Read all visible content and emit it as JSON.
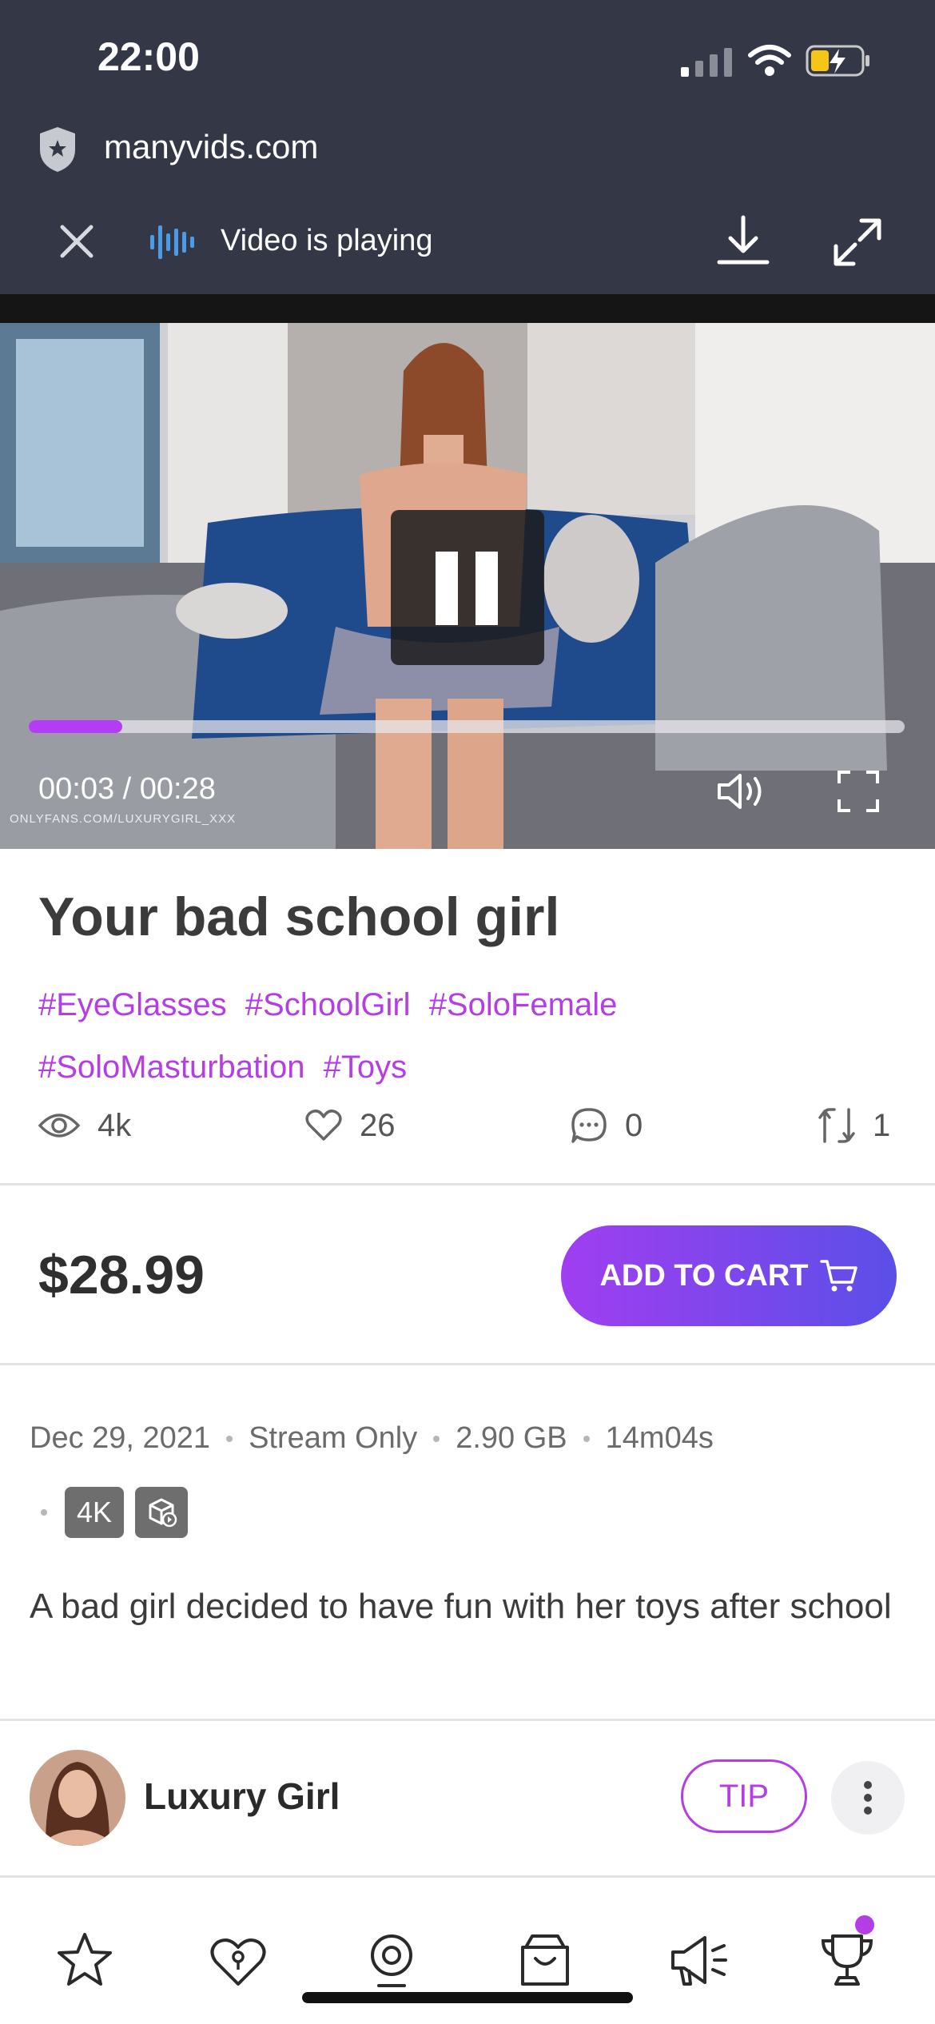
{
  "status_bar": {
    "time": "22:00"
  },
  "browser": {
    "url": "manyvids.com",
    "playing_label": "Video is playing"
  },
  "video": {
    "current_time": "00:03",
    "duration": "00:28",
    "time_display": "00:03 / 00:28",
    "progress_fraction": 0.107,
    "watermark": "ONLYFANS.COM/LUXURYGIRL_XXX"
  },
  "product": {
    "title": "Your bad school girl",
    "tags": [
      "#EyeGlasses",
      "#SchoolGirl",
      "#SoloFemale",
      "#SoloMasturbation",
      "#Toys"
    ],
    "stats": {
      "views": "4k",
      "likes": "26",
      "comments": "0",
      "reposts": "1"
    },
    "price": "$28.99",
    "add_to_cart_label": "ADD TO CART"
  },
  "details": {
    "date": "Dec 29, 2021",
    "stream": "Stream Only",
    "size": "2.90 GB",
    "length": "14m04s",
    "quality_badge": "4K",
    "description": "A bad girl decided to have fun with her toys after school"
  },
  "creator": {
    "name": "Luxury Girl",
    "tip_label": "TIP"
  },
  "colors": {
    "accent": "#b53de6",
    "header_bg": "#343846",
    "cart_gradient_start": "#a03ef0",
    "cart_gradient_end": "#5b4fe8"
  },
  "bottom_nav": [
    "star-icon",
    "heart-lock-icon",
    "webcam-icon",
    "shopping-bag-icon",
    "megaphone-icon",
    "trophy-icon"
  ]
}
